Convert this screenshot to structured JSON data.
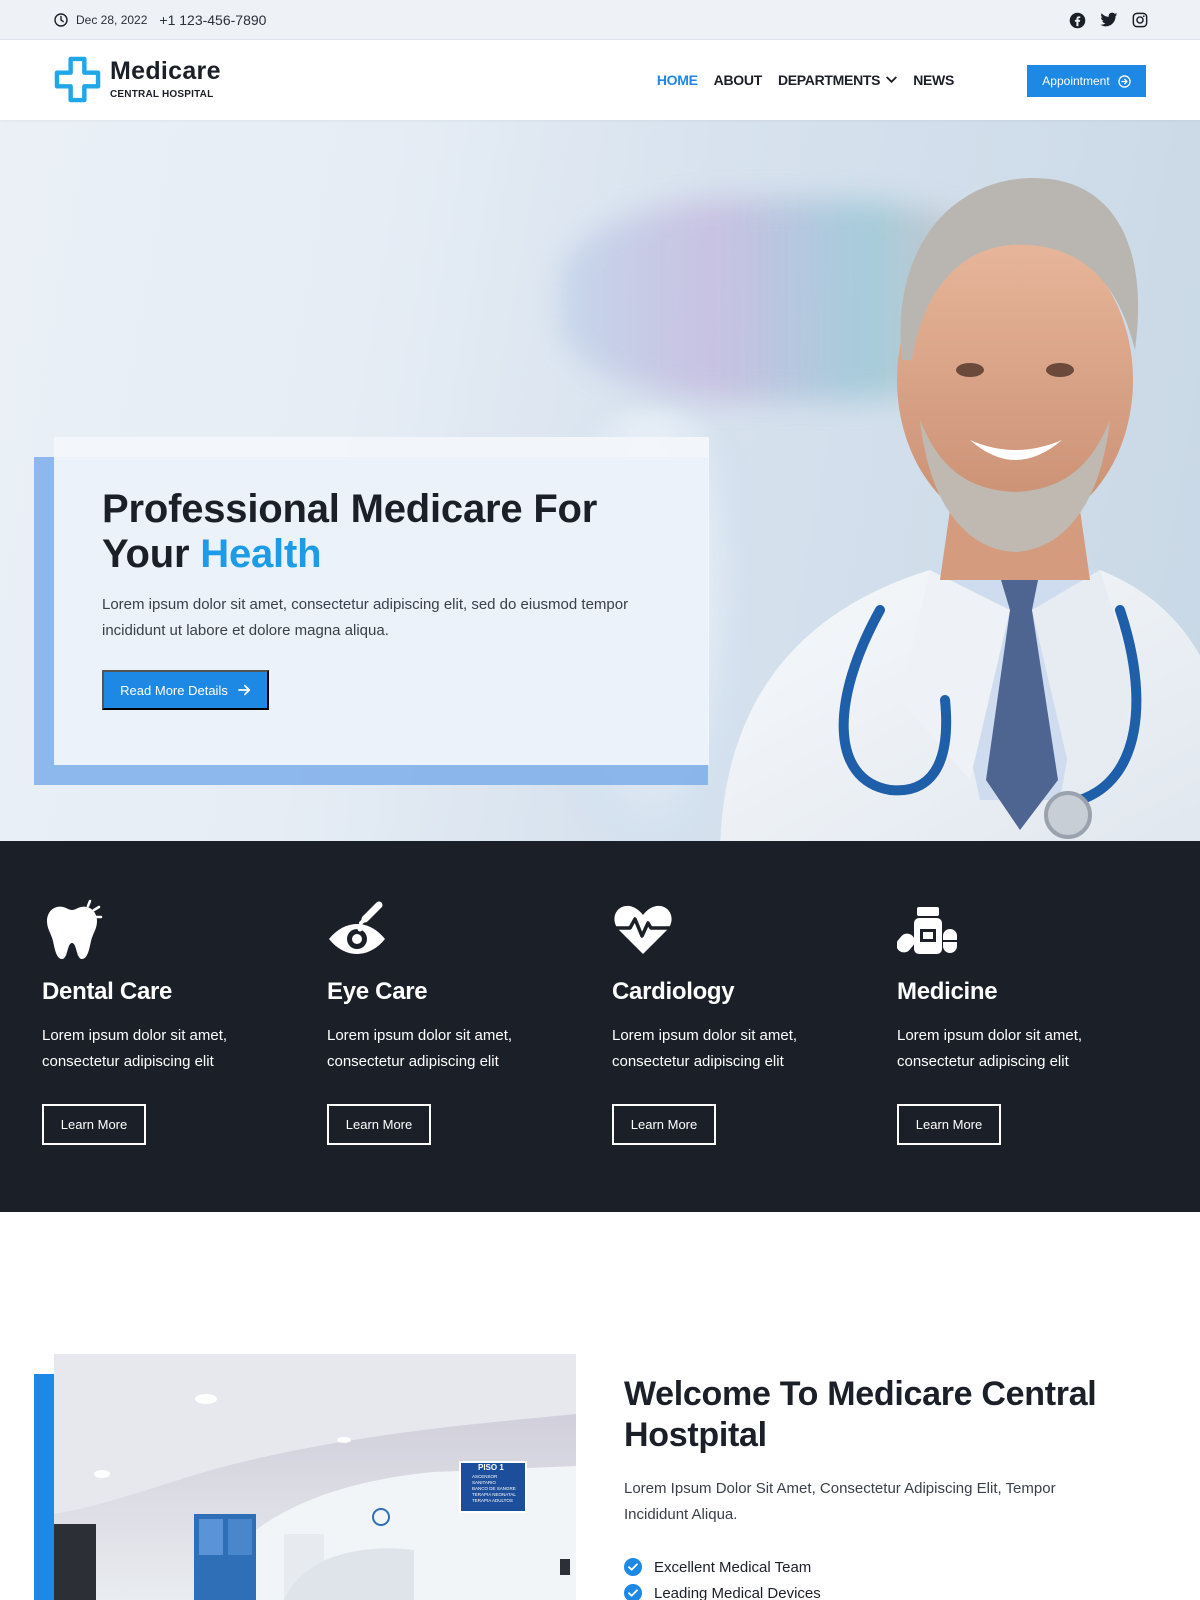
{
  "topbar": {
    "date": "Dec 28, 2022",
    "phone": "+1 123-456-7890",
    "social": [
      "facebook-icon",
      "twitter-icon",
      "instagram-icon"
    ]
  },
  "header": {
    "logo_name": "Medicare",
    "logo_subtitle": "CENTRAL HOSPITAL",
    "nav": [
      {
        "label": "HOME",
        "active": true
      },
      {
        "label": "ABOUT"
      },
      {
        "label": "DEPARTMENTS",
        "has_dropdown": true
      },
      {
        "label": "NEWS"
      }
    ],
    "appointment_label": "Appointment"
  },
  "hero": {
    "title_line1": "Professional Medicare For",
    "title_line2_prefix": "Your",
    "title_accent": "Health",
    "description": "Lorem ipsum dolor sit amet, consectetur adipiscing elit, sed do eiusmod tempor incididunt ut labore et dolore magna aliqua.",
    "button_label": "Read More Details"
  },
  "services": [
    {
      "icon": "tooth-icon",
      "title": "Dental Care",
      "text": "Lorem ipsum dolor sit amet, consectetur adipiscing elit",
      "button": "Learn More"
    },
    {
      "icon": "eye-dropper-icon",
      "title": "Eye Care",
      "text": "Lorem ipsum dolor sit amet, consectetur adipiscing elit",
      "button": "Learn More"
    },
    {
      "icon": "heart-pulse-icon",
      "title": "Cardiology",
      "text": "Lorem ipsum dolor sit amet, consectetur adipiscing elit",
      "button": "Learn More"
    },
    {
      "icon": "medicine-bottle-icon",
      "title": "Medicine",
      "text": "Lorem ipsum dolor sit amet, consectetur adipiscing elit",
      "button": "Learn More"
    }
  ],
  "welcome": {
    "title": "Welcome To Medicare Central Hostpital",
    "description": "Lorem Ipsum Dolor Sit Amet, Consectetur Adipiscing Elit, Tempor Incididunt Aliqua.",
    "features": [
      "Excellent Medical Team",
      "Leading Medical Devices"
    ],
    "sign_text": [
      "PISO 1",
      "ASCENSOR",
      "SANITARIO",
      "BANCO DE SANGRE",
      "TERAPIA NEONATAL",
      "TERAPIA ADULTOS"
    ]
  },
  "colors": {
    "accent": "#1e88e5",
    "accent_text": "#1e9be6",
    "dark": "#1b1f27",
    "topbar_bg": "#eef2f7"
  }
}
